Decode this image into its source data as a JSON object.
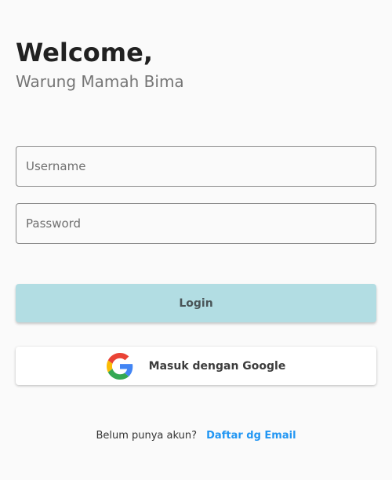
{
  "header": {
    "welcome": "Welcome,",
    "subtitle": "Warung Mamah Bima"
  },
  "form": {
    "username": {
      "value": "",
      "placeholder": "Username"
    },
    "password": {
      "value": "",
      "placeholder": "Password"
    },
    "login_label": "Login",
    "google_label": "Masuk dengan Google",
    "google_icon": "google-icon"
  },
  "signup": {
    "prompt": "Belum punya akun?",
    "link_label": "Daftar dg Email"
  },
  "colors": {
    "background": "#fafafa",
    "login_button": "#b2dde3",
    "link": "#2196f3",
    "google_blue": "#4285F4",
    "google_green": "#34A853",
    "google_yellow": "#FBBC05",
    "google_red": "#EA4335"
  }
}
